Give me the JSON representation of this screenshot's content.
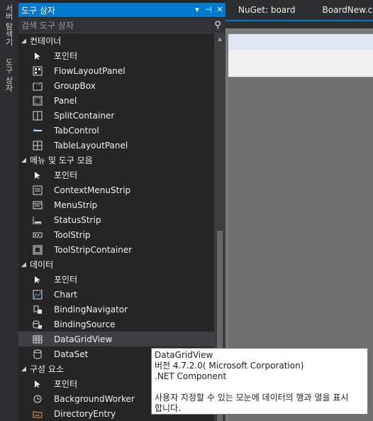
{
  "left_strip": {
    "server_explorer": "서버 탐색기",
    "toolbox_tab": "도구 상자"
  },
  "toolbox": {
    "title": "도구 상자",
    "search_placeholder": "검색 도구 상자",
    "sections": [
      {
        "name": "컨테이너",
        "items": [
          {
            "label": "포인터",
            "icon": "pointer-icon"
          },
          {
            "label": "FlowLayoutPanel",
            "icon": "flowlayoutpanel-icon"
          },
          {
            "label": "GroupBox",
            "icon": "groupbox-icon"
          },
          {
            "label": "Panel",
            "icon": "panel-icon"
          },
          {
            "label": "SplitContainer",
            "icon": "splitcontainer-icon"
          },
          {
            "label": "TabControl",
            "icon": "tabcontrol-icon"
          },
          {
            "label": "TableLayoutPanel",
            "icon": "tablelayoutpanel-icon"
          }
        ]
      },
      {
        "name": "메뉴 및 도구 모음",
        "items": [
          {
            "label": "포인터",
            "icon": "pointer-icon"
          },
          {
            "label": "ContextMenuStrip",
            "icon": "contextmenustrip-icon"
          },
          {
            "label": "MenuStrip",
            "icon": "menustrip-icon"
          },
          {
            "label": "StatusStrip",
            "icon": "statusstrip-icon"
          },
          {
            "label": "ToolStrip",
            "icon": "toolstrip-icon"
          },
          {
            "label": "ToolStripContainer",
            "icon": "toolstripcontainer-icon"
          }
        ]
      },
      {
        "name": "데이터",
        "items": [
          {
            "label": "포인터",
            "icon": "pointer-icon"
          },
          {
            "label": "Chart",
            "icon": "chart-icon"
          },
          {
            "label": "BindingNavigator",
            "icon": "bindingnavigator-icon"
          },
          {
            "label": "BindingSource",
            "icon": "bindingsource-icon"
          },
          {
            "label": "DataGridView",
            "icon": "datagridview-icon",
            "selected": true
          },
          {
            "label": "DataSet",
            "icon": "dataset-icon"
          }
        ]
      },
      {
        "name": "구성 요소",
        "items": [
          {
            "label": "포인터",
            "icon": "pointer-icon"
          },
          {
            "label": "BackgroundWorker",
            "icon": "backgroundworker-icon"
          },
          {
            "label": "DirectoryEntry",
            "icon": "directoryentry-icon"
          }
        ]
      }
    ]
  },
  "doc_tabs": [
    "NuGet: board",
    "BoardNew.cs"
  ],
  "tooltip": {
    "name": "DataGridView",
    "version": "버전 4.7.2.0( Microsoft Corporation)",
    "type": ".NET Component",
    "desc1": "사용자 지정할 수 있는 모눈에 데이터의 행과 열을 표시",
    "desc2": "합니다."
  },
  "colors": {
    "accent": "#007acc",
    "panel": "#252526",
    "selected": "#3f3f46"
  }
}
